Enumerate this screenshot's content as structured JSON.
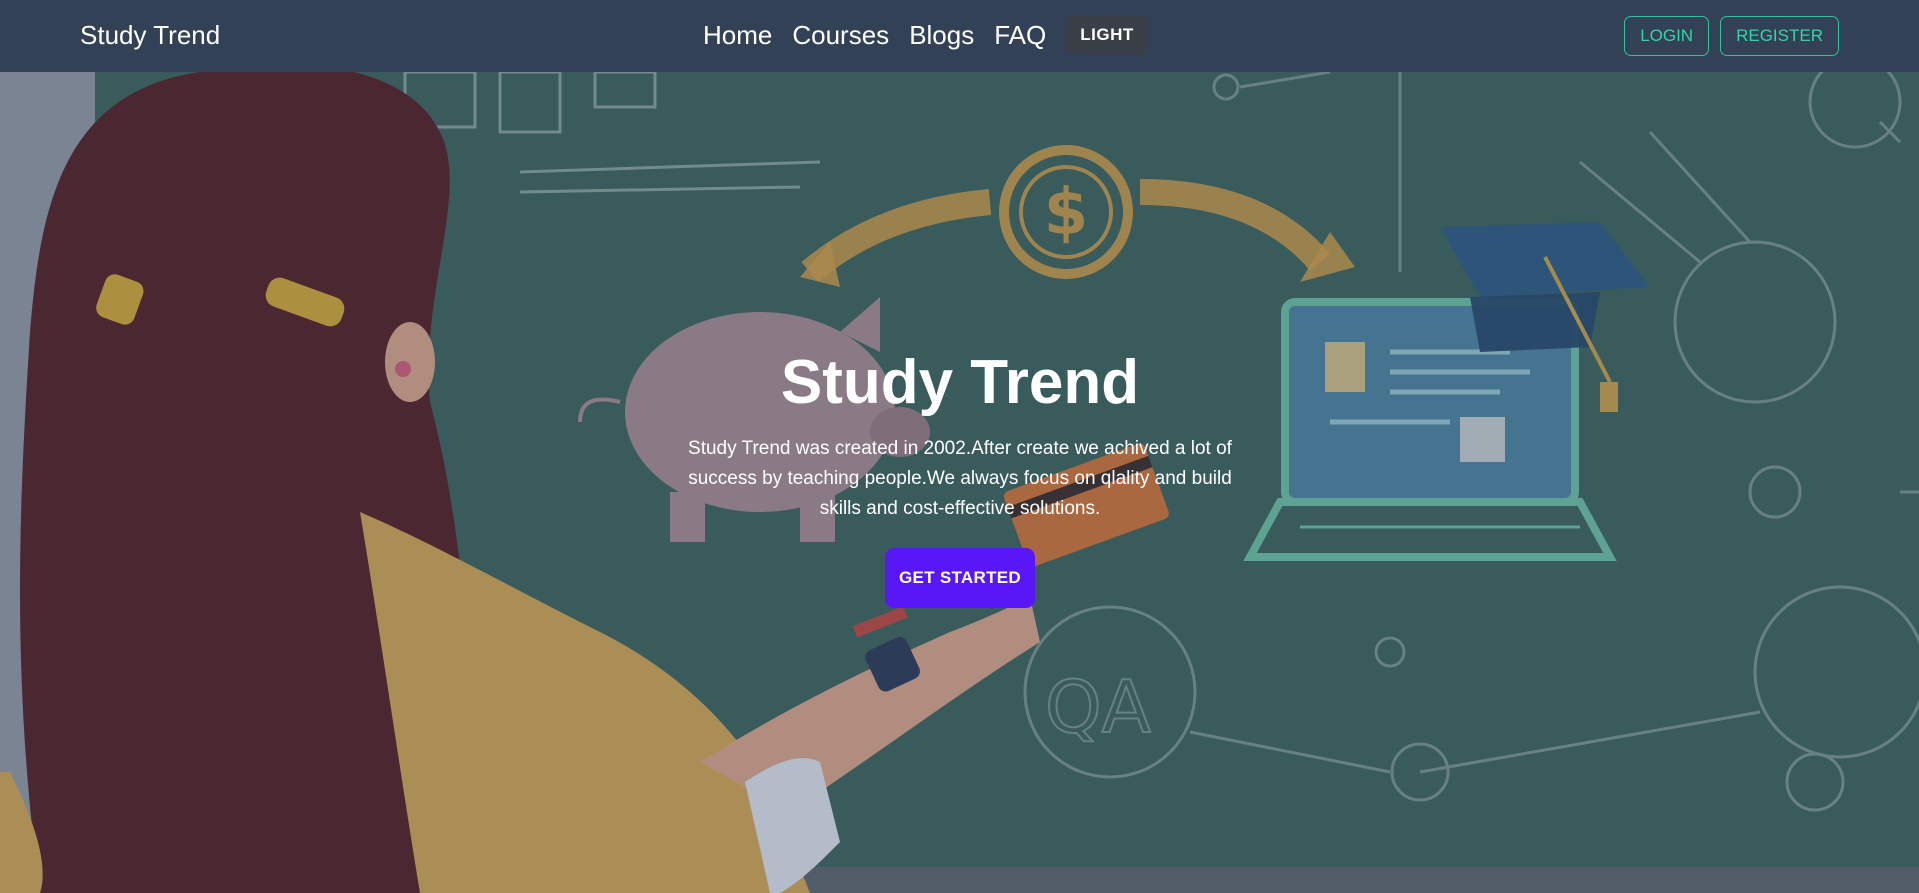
{
  "nav": {
    "brand": "Study Trend",
    "links": [
      "Home",
      "Courses",
      "Blogs",
      "FAQ"
    ],
    "theme_toggle": "LIGHT",
    "login": "LOGIN",
    "register": "REGISTER"
  },
  "hero": {
    "title": "Study Trend",
    "description": "Study Trend was created in 2002.After create we achived a lot of success by teaching people.We always focus on qlality and build skills and cost-effective solutions.",
    "cta": "GET STARTED"
  },
  "colors": {
    "navbar": "#324155",
    "accent_teal": "#36d3a6",
    "cta_purple": "#5a17f5",
    "chalkboard": "#3d6461"
  },
  "icons": [
    "dollar-icon",
    "graduation-cap-icon",
    "laptop-icon",
    "piggy-bank-icon",
    "magnifier-icon"
  ]
}
